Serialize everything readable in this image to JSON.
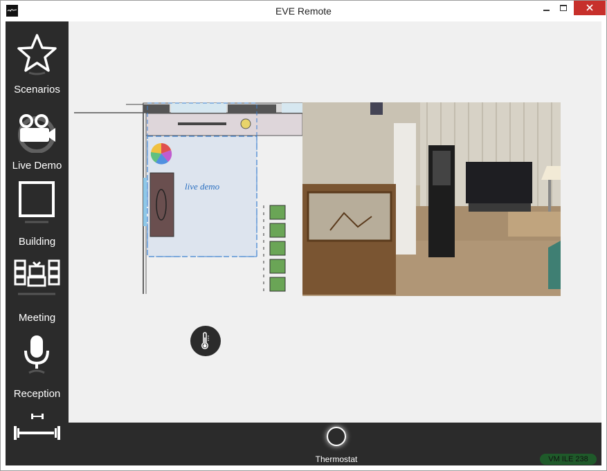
{
  "window": {
    "title": "EVE Remote"
  },
  "sidebar": {
    "items": [
      {
        "label": "Scenarios",
        "icon": "star-icon"
      },
      {
        "label": "Live Demo",
        "icon": "video-camera-icon"
      },
      {
        "label": "Building",
        "icon": "square-icon"
      },
      {
        "label": "Meeting",
        "icon": "meeting-room-icon"
      },
      {
        "label": "Reception",
        "icon": "microphone-icon"
      },
      {
        "label": "",
        "icon": "dumbbell-icon"
      }
    ]
  },
  "main": {
    "floorplan": {
      "room_label": "live demo"
    },
    "thermostat_icon": "thermometer-icon"
  },
  "bottombar": {
    "thermostat_label": "Thermostat",
    "status": "VM ILE 238"
  }
}
